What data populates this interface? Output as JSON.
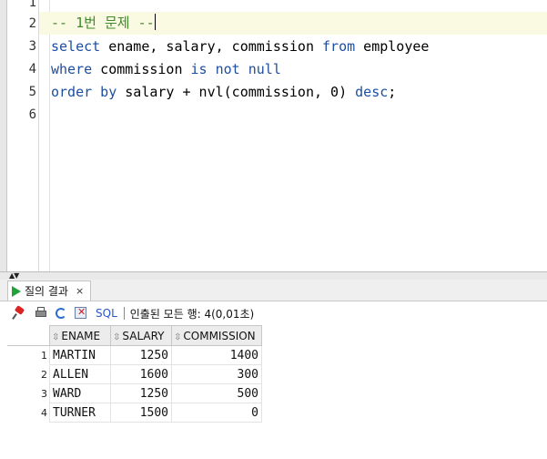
{
  "editor": {
    "line_numbers": [
      "1",
      "2",
      "3",
      "4",
      "5",
      "6"
    ],
    "line2": {
      "comment": "-- 1번 문제 --"
    },
    "line3": {
      "kw1": "select",
      "t1": " ename, salary, commission ",
      "kw2": "from",
      "t2": " employee"
    },
    "line4": {
      "kw1": "where",
      "t1": " commission ",
      "kw2": "is not null",
      "t2": ""
    },
    "line5": {
      "kw1": "order by",
      "t1": " salary + nvl(commission, 0) ",
      "kw2": "desc",
      "t2": ";"
    }
  },
  "results": {
    "tab_label": "질의 결과",
    "tab_close": "×",
    "sql_label": "SQL",
    "fetch_info": "인출된 모든 행: 4(0,01초)",
    "columns": [
      "ENAME",
      "SALARY",
      "COMMISSION"
    ],
    "rows": [
      {
        "n": "1",
        "ename": "MARTIN",
        "salary": "1250",
        "commission": "1400"
      },
      {
        "n": "2",
        "ename": "ALLEN",
        "salary": "1600",
        "commission": "300"
      },
      {
        "n": "3",
        "ename": "WARD",
        "salary": "1250",
        "commission": "500"
      },
      {
        "n": "4",
        "ename": "TURNER",
        "salary": "1500",
        "commission": "0"
      }
    ]
  },
  "colors": {
    "keyword": "#1e4ea0",
    "comment": "#3e8a2c",
    "run_icon": "#22a23a"
  }
}
